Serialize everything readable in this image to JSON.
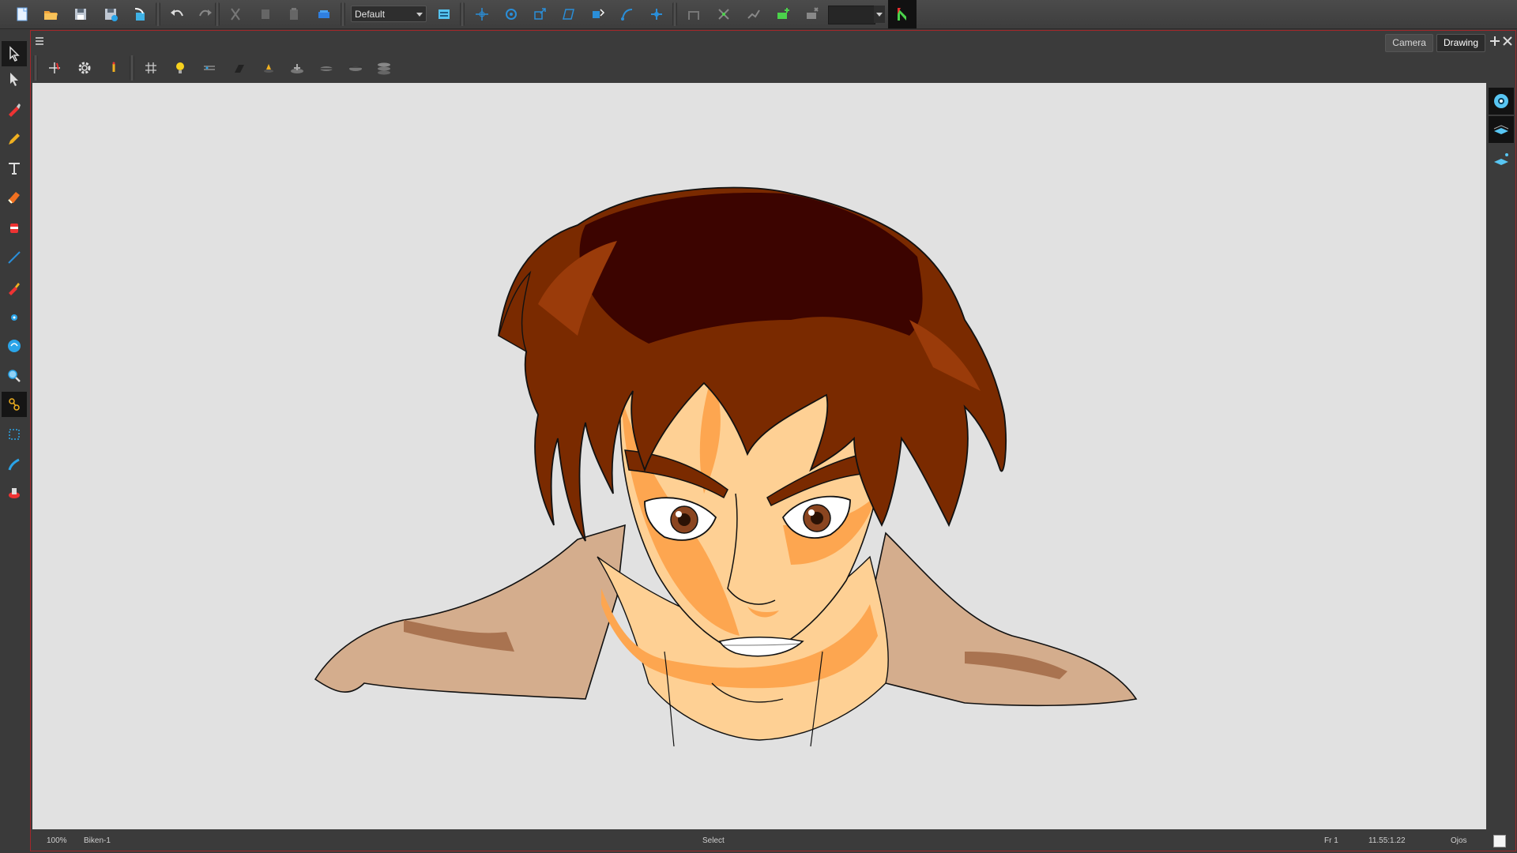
{
  "toolbar": {
    "workspace_value": "Default",
    "buttons": [
      "new-scene-icon",
      "open-scene-icon",
      "save-icon",
      "save-as-icon",
      "import-icon",
      "undo-icon",
      "redo-icon",
      "cut-icon",
      "copy-icon",
      "paste-icon",
      "library-icon",
      "workspace-manager-icon",
      "transform-icon",
      "rotate-icon",
      "scale-icon",
      "skew-icon",
      "maintain-size-icon",
      "spline-offset-icon",
      "pivot-icon",
      "bone-icon",
      "kinematic-icon",
      "ik-icon",
      "add-keyframe-icon",
      "reset-icon",
      "color-swatch",
      "launcher-icon"
    ]
  },
  "left_tools": [
    "select-tool-icon",
    "contour-editor-icon",
    "brush-tool-icon",
    "pencil-tool-icon",
    "text-tool-icon",
    "eraser-tool-icon",
    "paint-tool-icon",
    "line-tool-icon",
    "dropper-tool-icon",
    "pivot-tool-icon",
    "morph-tool-icon",
    "zoom-tool-icon",
    "rigging-tool-icon",
    "cutter-tool-icon",
    "stroke-tool-icon",
    "ink-tool-icon"
  ],
  "view": {
    "tabs": [
      {
        "label": "Camera",
        "selected": false
      },
      {
        "label": "Drawing",
        "selected": true
      }
    ],
    "toolbar_buttons": [
      "reset-pan-icon",
      "settings-gear-icon",
      "light-table-icon",
      "grid-icon",
      "light-bulb-icon",
      "onion-skin-icon",
      "shade-icon",
      "underlay-icon",
      "color-art-icon",
      "line-art-icon",
      "overlay-icon",
      "layer-stack-icon"
    ]
  },
  "right_strip": [
    "view-mode-eye-icon",
    "line-art-layer-icon",
    "color-art-layer-icon"
  ],
  "status": {
    "zoom": "100%",
    "drawing_name": "Biken-1",
    "tool": "Select",
    "frame": "Fr 1",
    "coordinates": "11.55:1.22",
    "layer": "Ojos"
  },
  "colors": {
    "accent_border": "#a3272a",
    "hair_dark": "#3c0400",
    "hair_mid": "#7a2a00",
    "hair_light": "#9a3b0a",
    "skin_light": "#fed094",
    "skin_shadow": "#fda650",
    "shirt": "#d4ad8d",
    "shirt_shadow": "#a97350"
  }
}
